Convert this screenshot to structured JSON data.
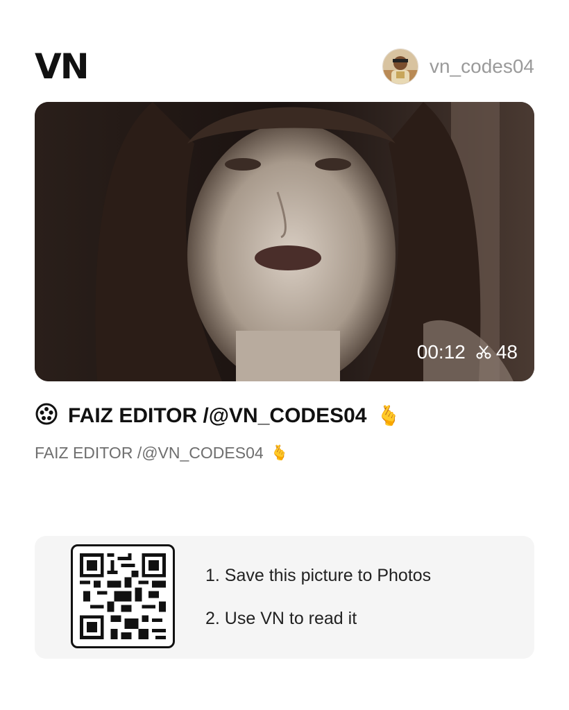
{
  "header": {
    "logo_text": "VN",
    "username": "vn_codes04"
  },
  "preview": {
    "duration": "00:12",
    "clip_count": "48"
  },
  "project": {
    "title": "FAIZ EDITOR /@VN_CODES04",
    "subtitle": "FAIZ EDITOR /@VN_CODES04",
    "emoji": "🫰"
  },
  "qr_card": {
    "steps": [
      "1. Save this picture to Photos",
      "2. Use VN to read it"
    ]
  },
  "icons": {
    "film_reel": "film-reel-icon",
    "scissors": "scissors-icon",
    "hand": "hand-heart-emoji"
  },
  "colors": {
    "accent_text": "#111111",
    "username_gray": "#9a9a9a",
    "card_bg": "#f5f5f5"
  }
}
